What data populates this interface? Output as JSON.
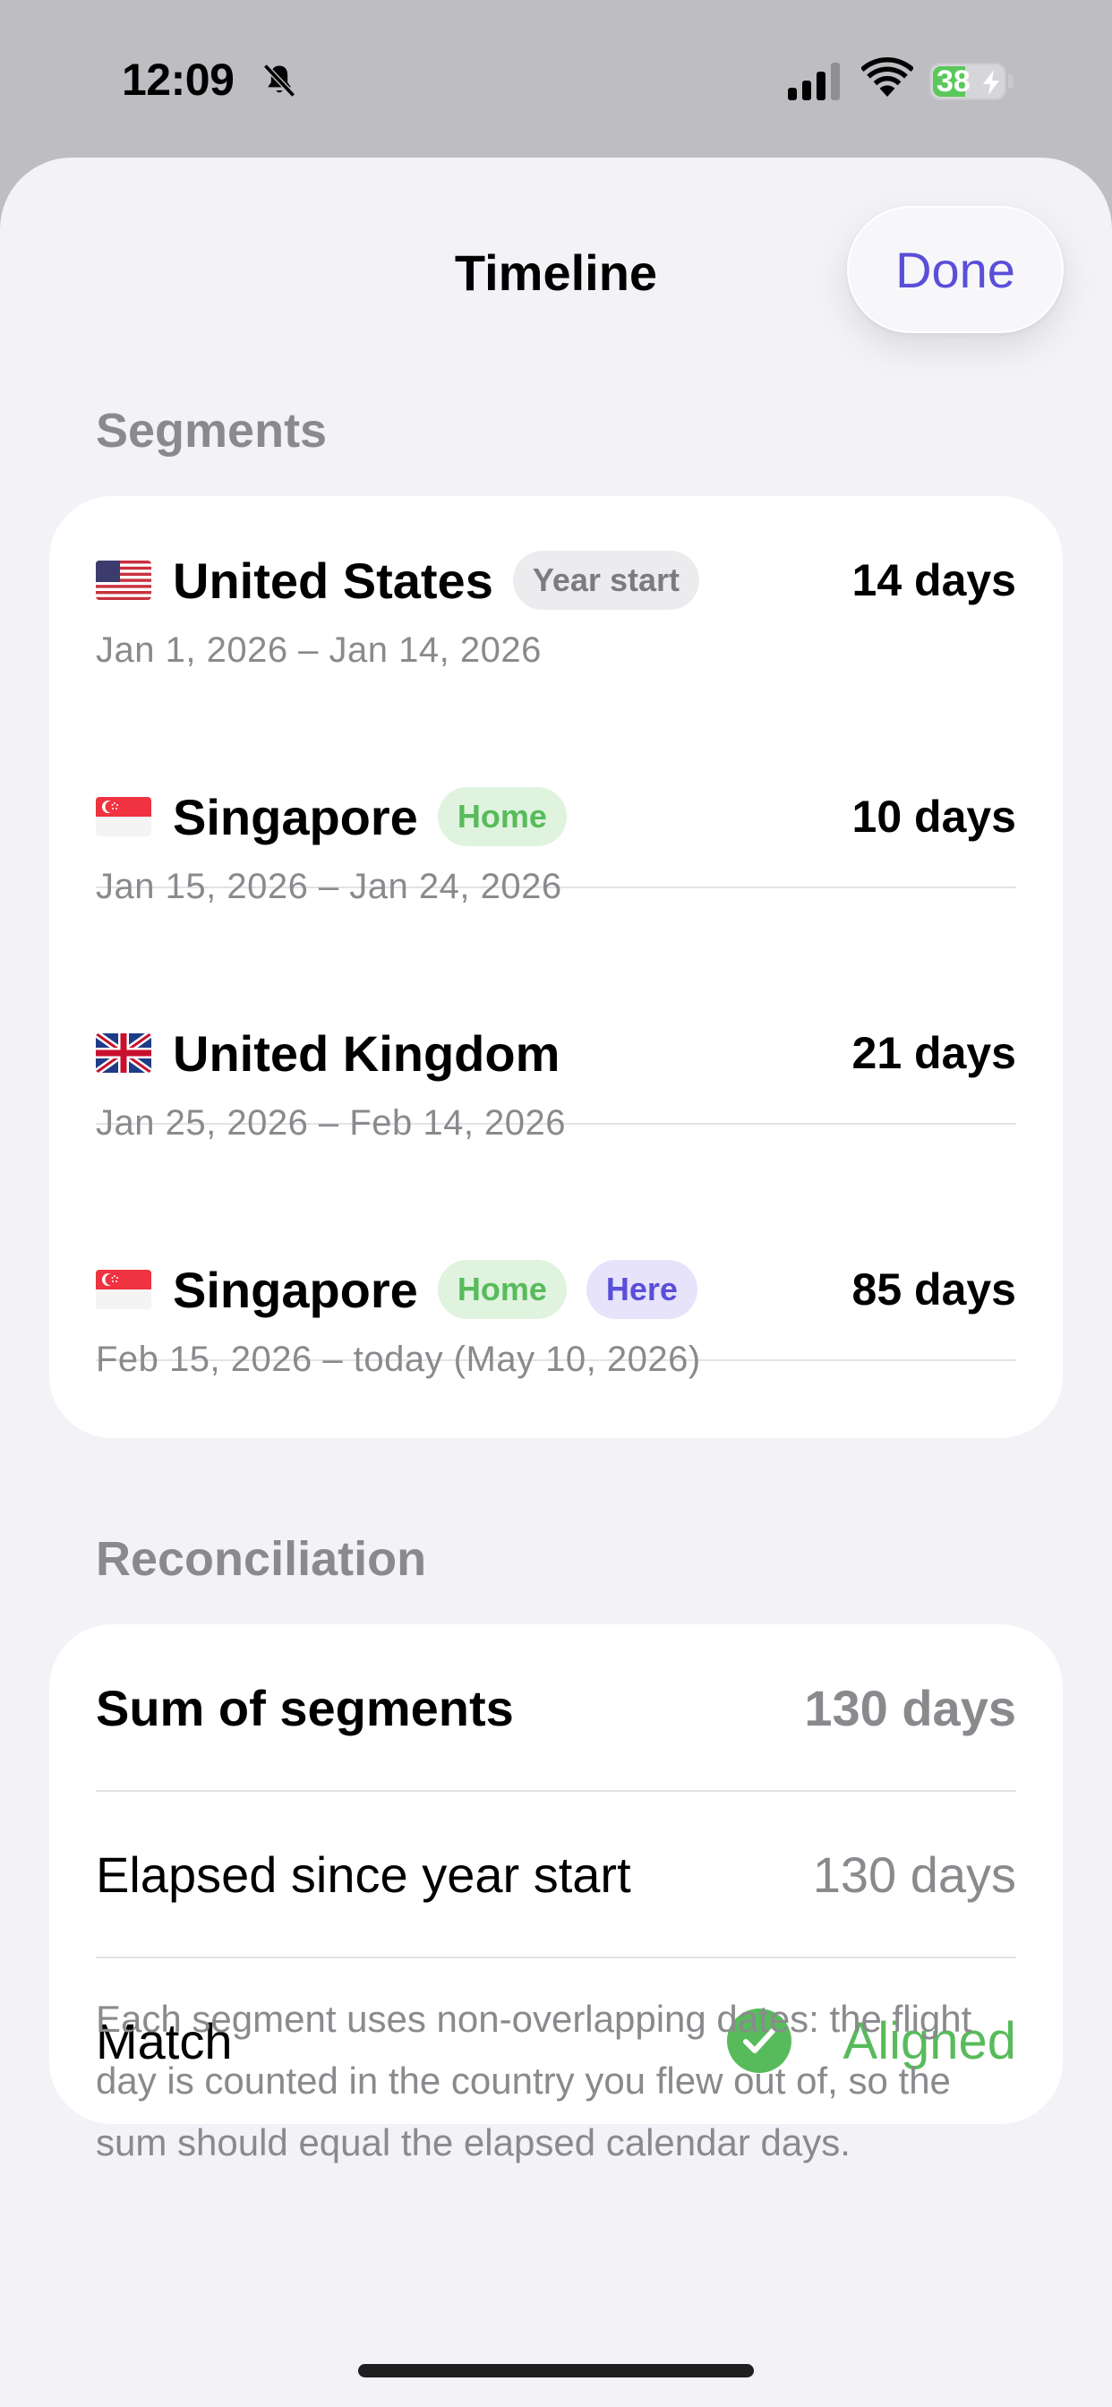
{
  "status_bar": {
    "time": "12:09",
    "battery": "38"
  },
  "header": {
    "title": "Timeline",
    "done_label": "Done"
  },
  "segments_section": {
    "header": "Segments",
    "items": [
      {
        "flag": "us-flag-icon",
        "country": "United States",
        "tags": [
          "Year start"
        ],
        "days": "14 days",
        "dates": "Jan 1, 2026 – Jan 14, 2026"
      },
      {
        "flag": "sg-flag-icon",
        "country": "Singapore",
        "tags": [
          "Home"
        ],
        "days": "10 days",
        "dates": "Jan 15, 2026 – Jan 24, 2026"
      },
      {
        "flag": "gb-flag-icon",
        "country": "United Kingdom",
        "tags": [],
        "days": "21 days",
        "dates": "Jan 25, 2026 – Feb 14, 2026"
      },
      {
        "flag": "sg-flag-icon",
        "country": "Singapore",
        "tags": [
          "Home",
          "Here"
        ],
        "days": "85 days",
        "dates": "Feb 15, 2026 – today (May 10, 2026)"
      }
    ]
  },
  "reconciliation_section": {
    "header": "Reconciliation",
    "rows": [
      {
        "label": "Sum of segments",
        "value": "130 days"
      },
      {
        "label": "Elapsed since year start",
        "value": "130 days"
      },
      {
        "label": "Match",
        "value": "Aligned"
      }
    ]
  },
  "footnote": "Each segment uses non-overlapping dates: the flight day is counted in the country you flew out of, so the sum should equal the elapsed calendar days.",
  "colors": {
    "accent": "#5a4fd9",
    "success": "#58bb5b",
    "secondary_text": "#8a8a8e",
    "background": "#f2f2f7"
  }
}
